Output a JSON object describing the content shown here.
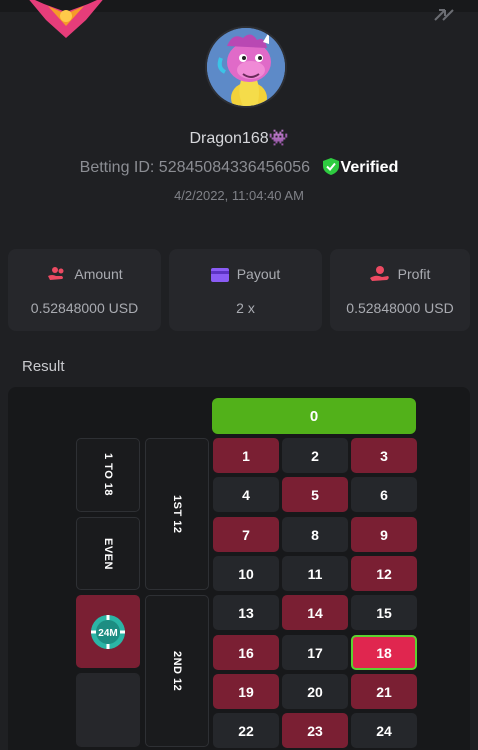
{
  "profile": {
    "username": "Dragon168👾",
    "betting_id_label": "Betting ID: 52845084336456056",
    "verified_label": "Verified",
    "timestamp": "4/2/2022, 11:04:40 AM"
  },
  "stats": {
    "amount": {
      "label": "Amount",
      "value": "0.52848000 USD"
    },
    "payout": {
      "label": "Payout",
      "value": "2 x"
    },
    "profit": {
      "label": "Profit",
      "value": "0.52848000 USD"
    }
  },
  "result": {
    "title": "Result",
    "zero": "0",
    "numbers": [
      {
        "n": "1",
        "color": "red"
      },
      {
        "n": "2",
        "color": "black"
      },
      {
        "n": "3",
        "color": "red"
      },
      {
        "n": "4",
        "color": "black"
      },
      {
        "n": "5",
        "color": "red"
      },
      {
        "n": "6",
        "color": "black"
      },
      {
        "n": "7",
        "color": "red"
      },
      {
        "n": "8",
        "color": "black"
      },
      {
        "n": "9",
        "color": "red"
      },
      {
        "n": "10",
        "color": "black"
      },
      {
        "n": "11",
        "color": "black"
      },
      {
        "n": "12",
        "color": "red"
      },
      {
        "n": "13",
        "color": "black"
      },
      {
        "n": "14",
        "color": "red"
      },
      {
        "n": "15",
        "color": "black"
      },
      {
        "n": "16",
        "color": "red"
      },
      {
        "n": "17",
        "color": "black"
      },
      {
        "n": "18",
        "color": "red"
      },
      {
        "n": "19",
        "color": "red"
      },
      {
        "n": "20",
        "color": "black"
      },
      {
        "n": "21",
        "color": "red"
      },
      {
        "n": "22",
        "color": "black"
      },
      {
        "n": "23",
        "color": "red"
      },
      {
        "n": "24",
        "color": "black"
      }
    ],
    "winning_number": "18",
    "outside": {
      "one_to_18": "1 TO 18",
      "even": "EVEN",
      "first_12": "1ST 12",
      "second_12": "2ND 12",
      "chip": "24M"
    }
  },
  "colors": {
    "background": "#1f2023",
    "red_cell": "#7a1f33",
    "black_cell": "#25272b",
    "zero": "#52b11a",
    "highlight": "#e0264f",
    "verified": "#2ecc40"
  }
}
